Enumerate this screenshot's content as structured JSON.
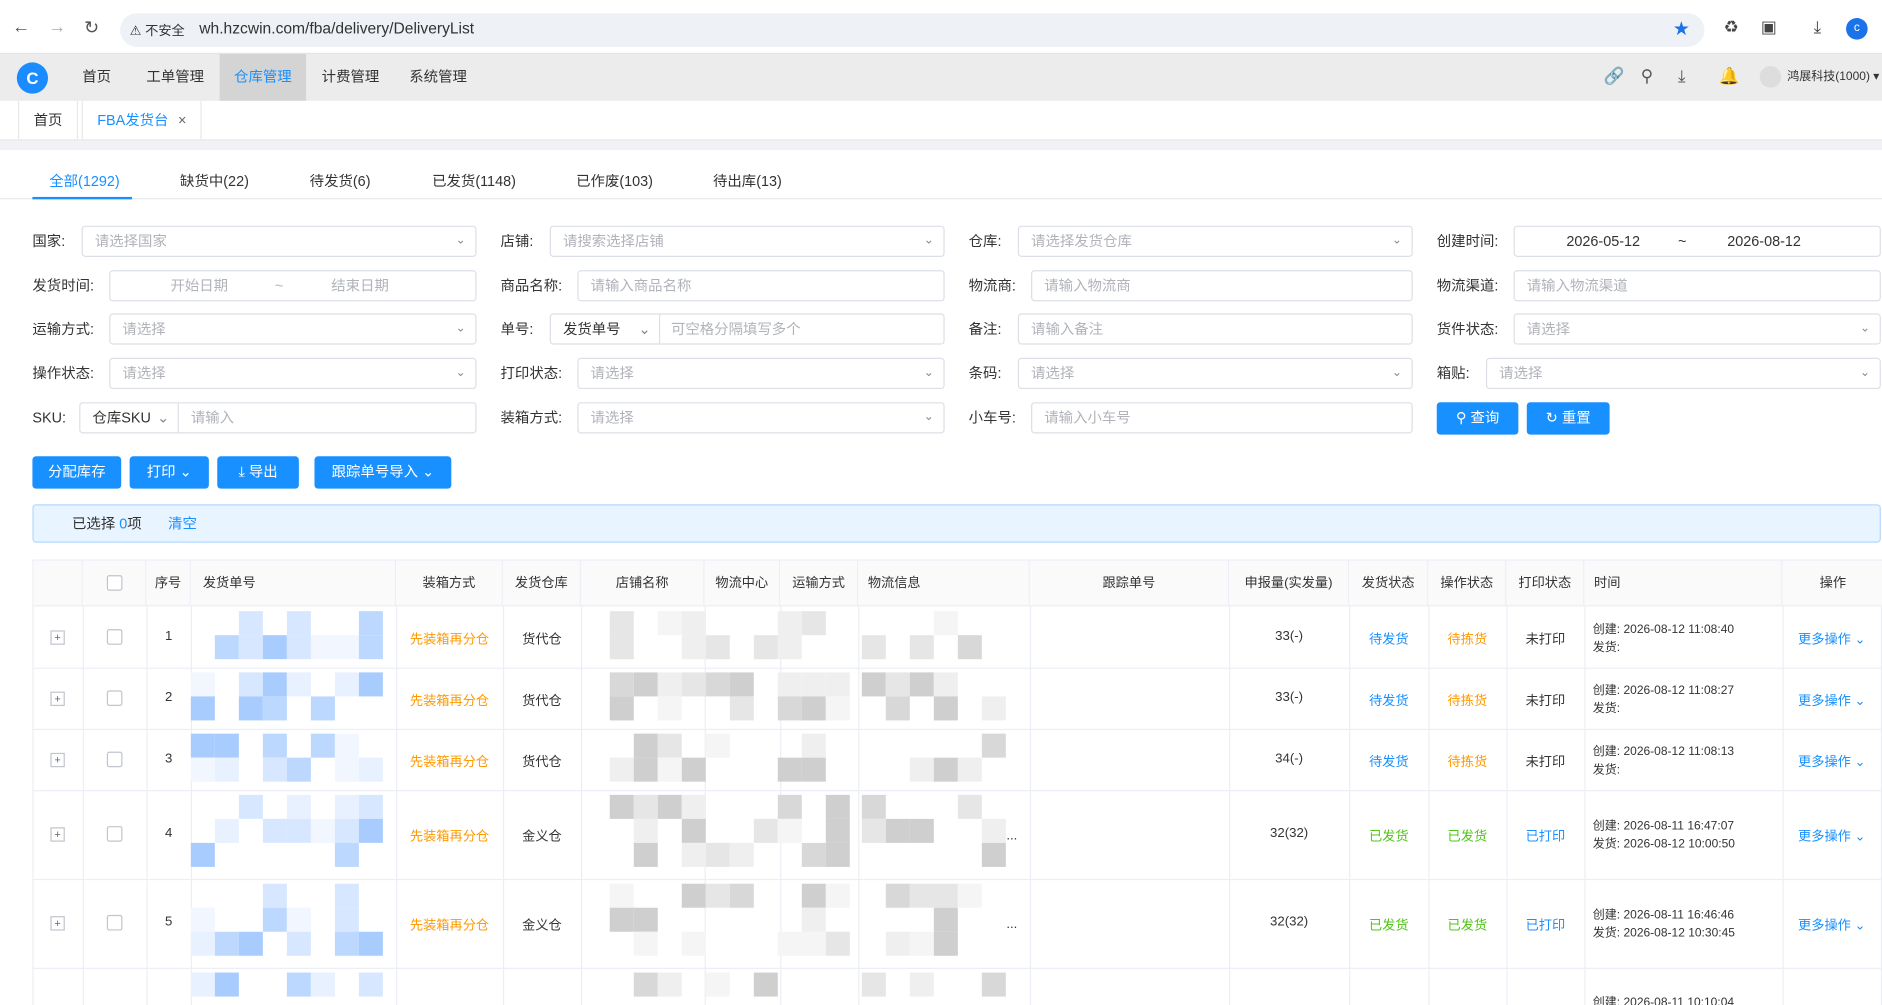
{
  "browser": {
    "insecure": "不安全",
    "url": "wh.hzcwin.com/fba/delivery/DeliveryList",
    "profile_initial": "c"
  },
  "app": {
    "menu": [
      "首页",
      "工单管理",
      "仓库管理",
      "计费管理",
      "系统管理"
    ],
    "active_menu": "仓库管理",
    "user": "鸿展科技(1000)"
  },
  "page_tabs": [
    {
      "label": "首页"
    },
    {
      "label": "FBA发货台",
      "close": "×"
    }
  ],
  "status_tabs": [
    "全部(1292)",
    "缺货中(22)",
    "待发货(6)",
    "已发货(1148)",
    "已作废(103)",
    "待出库(13)"
  ],
  "filters": {
    "country": {
      "label": "国家:",
      "placeholder": "请选择国家"
    },
    "shop": {
      "label": "店铺:",
      "placeholder": "请搜索选择店铺"
    },
    "warehouse": {
      "label": "仓库:",
      "placeholder": "请选择发货仓库"
    },
    "created": {
      "label": "创建时间:",
      "start": "2026-05-12",
      "sep": "~",
      "end": "2026-08-12"
    },
    "ship_time": {
      "label": "发货时间:",
      "start": "开始日期",
      "sep": "~",
      "end": "结束日期"
    },
    "product_name": {
      "label": "商品名称:",
      "placeholder": "请输入商品名称"
    },
    "carrier": {
      "label": "物流商:",
      "placeholder": "请输入物流商"
    },
    "channel": {
      "label": "物流渠道:",
      "placeholder": "请输入物流渠道"
    },
    "transport": {
      "label": "运输方式:",
      "placeholder": "请选择"
    },
    "order_no": {
      "label": "单号:",
      "type": "发货单号",
      "placeholder": "可空格分隔填写多个"
    },
    "remark": {
      "label": "备注:",
      "placeholder": "请输入备注"
    },
    "goods_status": {
      "label": "货件状态:",
      "placeholder": "请选择"
    },
    "op_status": {
      "label": "操作状态:",
      "placeholder": "请选择"
    },
    "print_status": {
      "label": "打印状态:",
      "placeholder": "请选择"
    },
    "barcode": {
      "label": "条码:",
      "placeholder": "请选择"
    },
    "box_label": {
      "label": "箱贴:",
      "placeholder": "请选择"
    },
    "sku": {
      "label": "SKU:",
      "type": "仓库SKU",
      "placeholder": "请输入"
    },
    "packing": {
      "label": "装箱方式:",
      "placeholder": "请选择"
    },
    "cart_no": {
      "label": "小车号:",
      "placeholder": "请输入小车号"
    },
    "search_button": "查询",
    "reset_button": "重置"
  },
  "actions": {
    "allocate": "分配库存",
    "print": "打印",
    "export": "导出",
    "tracking_import": "跟踪单号导入"
  },
  "selection": {
    "prefix": "已选择",
    "count": "0",
    "suffix": "项",
    "clear": "清空"
  },
  "table": {
    "headers": [
      "序号",
      "发货单号",
      "装箱方式",
      "发货仓库",
      "店铺名称",
      "物流中心",
      "运输方式",
      "物流信息",
      "跟踪单号",
      "申报量(实发量)",
      "发货状态",
      "操作状态",
      "打印状态",
      "时间",
      "操作"
    ],
    "created_prefix": "创建:",
    "shipped_prefix": "发货:",
    "more_ops": "更多操作",
    "rows": [
      {
        "idx": "1",
        "packing": "先装箱再分仓",
        "warehouse": "货代仓",
        "qty": "33(-)",
        "ship_status": "待发货",
        "op_status": "待拣货",
        "print_status": "未打印",
        "created": "2026-08-12 11:08:40",
        "shipped": ""
      },
      {
        "idx": "2",
        "packing": "先装箱再分仓",
        "warehouse": "货代仓",
        "qty": "33(-)",
        "ship_status": "待发货",
        "op_status": "待拣货",
        "print_status": "未打印",
        "created": "2026-08-12 11:08:27",
        "shipped": ""
      },
      {
        "idx": "3",
        "packing": "先装箱再分仓",
        "warehouse": "货代仓",
        "qty": "34(-)",
        "ship_status": "待发货",
        "op_status": "待拣货",
        "print_status": "未打印",
        "created": "2026-08-12 11:08:13",
        "shipped": ""
      },
      {
        "idx": "4",
        "packing": "先装箱再分仓",
        "warehouse": "金义仓",
        "qty": "32(32)",
        "ship_status": "已发货",
        "op_status": "已发货",
        "print_status": "已打印",
        "created": "2026-08-11 16:47:07",
        "shipped": "2026-08-12 10:00:50"
      },
      {
        "idx": "5",
        "packing": "先装箱再分仓",
        "warehouse": "金义仓",
        "qty": "32(32)",
        "ship_status": "已发货",
        "op_status": "已发货",
        "print_status": "已打印",
        "created": "2026-08-11 16:46:46",
        "shipped": "2026-08-12 10:30:45"
      },
      {
        "idx": "",
        "packing": "",
        "warehouse": "",
        "qty": "",
        "ship_status": "",
        "op_status": "",
        "print_status": "",
        "created": "2026-08-11 10:10:04",
        "shipped": ""
      }
    ]
  }
}
